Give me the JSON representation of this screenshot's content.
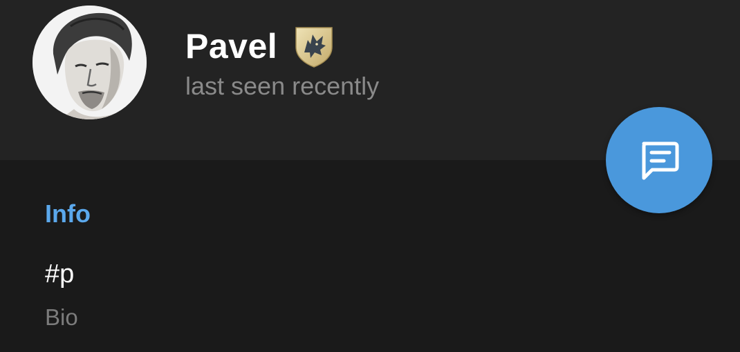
{
  "profile": {
    "name": "Pavel",
    "status": "last seen recently",
    "avatar_icon": "user-portrait",
    "badge_icon": "wolf-shield-badge"
  },
  "fab": {
    "icon": "message-icon",
    "color": "#4a98dc"
  },
  "info": {
    "section_title": "Info",
    "bio_value": "#p",
    "bio_label": "Bio"
  },
  "colors": {
    "background": "#1a1a1a",
    "header": "#232323",
    "accent": "#5ba8ec"
  }
}
